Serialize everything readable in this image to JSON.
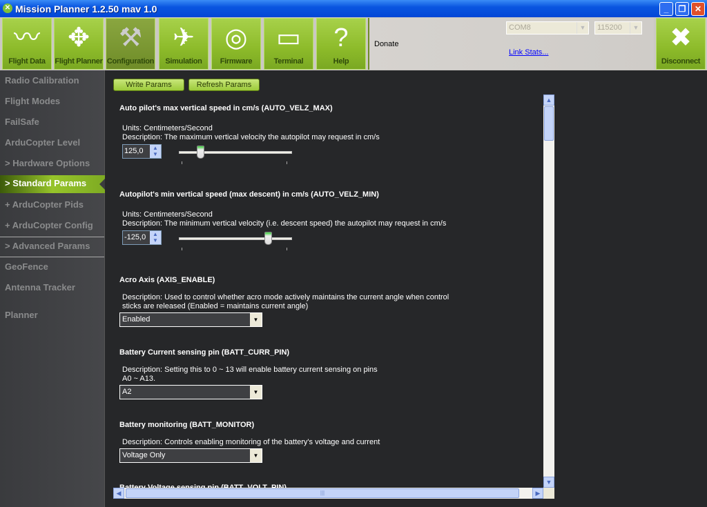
{
  "window": {
    "title": "Mission Planner 1.2.50 mav 1.0",
    "minimize": "_",
    "restore": "❐",
    "close": "✕"
  },
  "toolbar": {
    "buttons": [
      {
        "label": "Flight Data",
        "icon": "pulse-icon",
        "glyph": "〰"
      },
      {
        "label": "Flight Planner",
        "icon": "compass-icon",
        "glyph": "✥"
      },
      {
        "label": "Configuration",
        "icon": "wrench-icon",
        "glyph": "🔧",
        "active": true
      },
      {
        "label": "Simulation",
        "icon": "computer-plane-icon",
        "glyph": "✈"
      },
      {
        "label": "Firmware",
        "icon": "disc-icon",
        "glyph": "◎"
      },
      {
        "label": "Terminal",
        "icon": "terminal-icon",
        "glyph": "▭"
      },
      {
        "label": "Help",
        "icon": "question-icon",
        "glyph": "?"
      }
    ],
    "donate": "Donate",
    "port": "COM8",
    "baud": "115200",
    "link_stats": "Link Stats...",
    "disconnect": {
      "label": "Disconnect",
      "icon": "plug-icon",
      "glyph": "✖"
    }
  },
  "sidebar": {
    "items": [
      "Radio Calibration",
      "Flight Modes",
      "FailSafe",
      "ArduCopter Level",
      "> Hardware Options",
      "> Standard Params",
      "+ ArduCopter Pids",
      "+ ArduCopter Config",
      "> Advanced Params",
      "GeoFence",
      "Antenna Tracker",
      "Planner"
    ],
    "active": "> Standard Params"
  },
  "actions": {
    "write": "Write Params",
    "refresh": "Refresh Params"
  },
  "params": [
    {
      "title": "Auto pilot's max vertical speed in cm/s (AUTO_VELZ_MAX)",
      "units": "Units: Centimeters/Second",
      "description": "Description: The maximum vertical velocity the autopilot may request in cm/s",
      "value": "125,0",
      "slider_fraction": 0.18
    },
    {
      "title": "Autopilot's min vertical speed (max descent) in cm/s (AUTO_VELZ_MIN)",
      "units": "Units: Centimeters/Second",
      "description": "Description: The minimum vertical velocity (i.e. descent speed) the autopilot may request in cm/s",
      "value": "-125,0",
      "slider_fraction": 0.82
    },
    {
      "title": "Acro Axis (AXIS_ENABLE)",
      "description": "Description: Used to control whether acro mode actively maintains the current angle when control",
      "description2": "sticks are released (Enabled = maintains current angle)",
      "value": "Enabled"
    },
    {
      "title": "Battery Current sensing pin (BATT_CURR_PIN)",
      "description": "Description: Setting this to 0 ~ 13 will enable battery current sensing on pins",
      "description2": "A0 ~ A13.",
      "value": "A2"
    },
    {
      "title": "Battery monitoring (BATT_MONITOR)",
      "description": "Description: Controls enabling monitoring of the battery's voltage and current",
      "value": "Voltage Only"
    },
    {
      "title": "Battery Voltage sensing pin (BATT_VOLT_PIN)"
    }
  ]
}
